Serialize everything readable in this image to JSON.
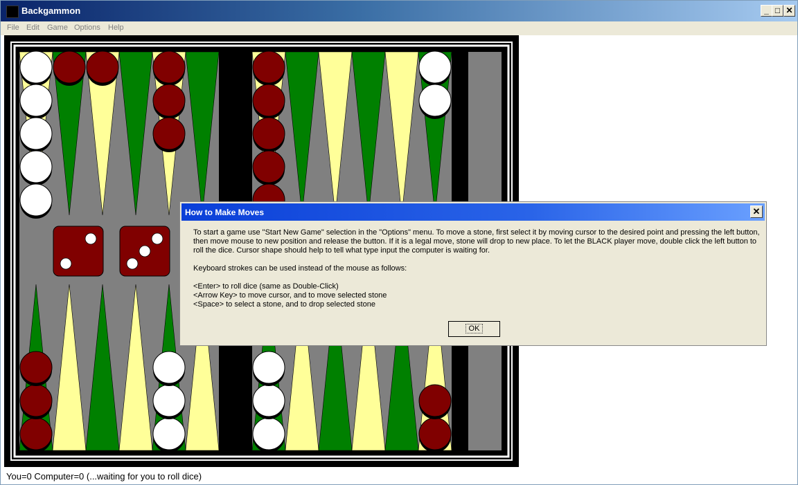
{
  "window": {
    "title": "Backgammon"
  },
  "window_controls": {
    "minimize": "_",
    "maximize": "□",
    "close": "✕"
  },
  "menu": [
    "File",
    "Edit",
    "Game",
    "Options",
    "Help"
  ],
  "dice": [
    2,
    3
  ],
  "status": "You=0 Computer=0 (...waiting for you to roll dice)",
  "dialog": {
    "title": "How to Make Moves",
    "close": "✕",
    "paragraph1": "To start a game use \"Start New Game\" selection in the \"Options\" menu.  To move a stone, first select it by moving cursor to the desired point and pressing the left button, then move mouse to new position and release the button.  If it is a legal move, stone will drop to new place.  To let the BLACK player move, double click the left button to roll the dice.  Cursor shape should help to tell what type input the computer is waiting for.",
    "paragraph2": "Keyboard strokes can be used instead of the mouse as follows:",
    "line1": "<Enter> to roll dice (same as Double-Click)",
    "line2": "<Arrow Key> to move cursor, and to move selected stone",
    "line3": "<Space> to select a stone, and to drop selected stone",
    "ok_label": "OK"
  },
  "colors": {
    "board_bg": "#808080",
    "frame": "#000000",
    "point_light": "#ffff99",
    "point_dark": "#008000",
    "stone_dark": "#800000",
    "stone_light": "#ffffff",
    "die": "#800000"
  }
}
